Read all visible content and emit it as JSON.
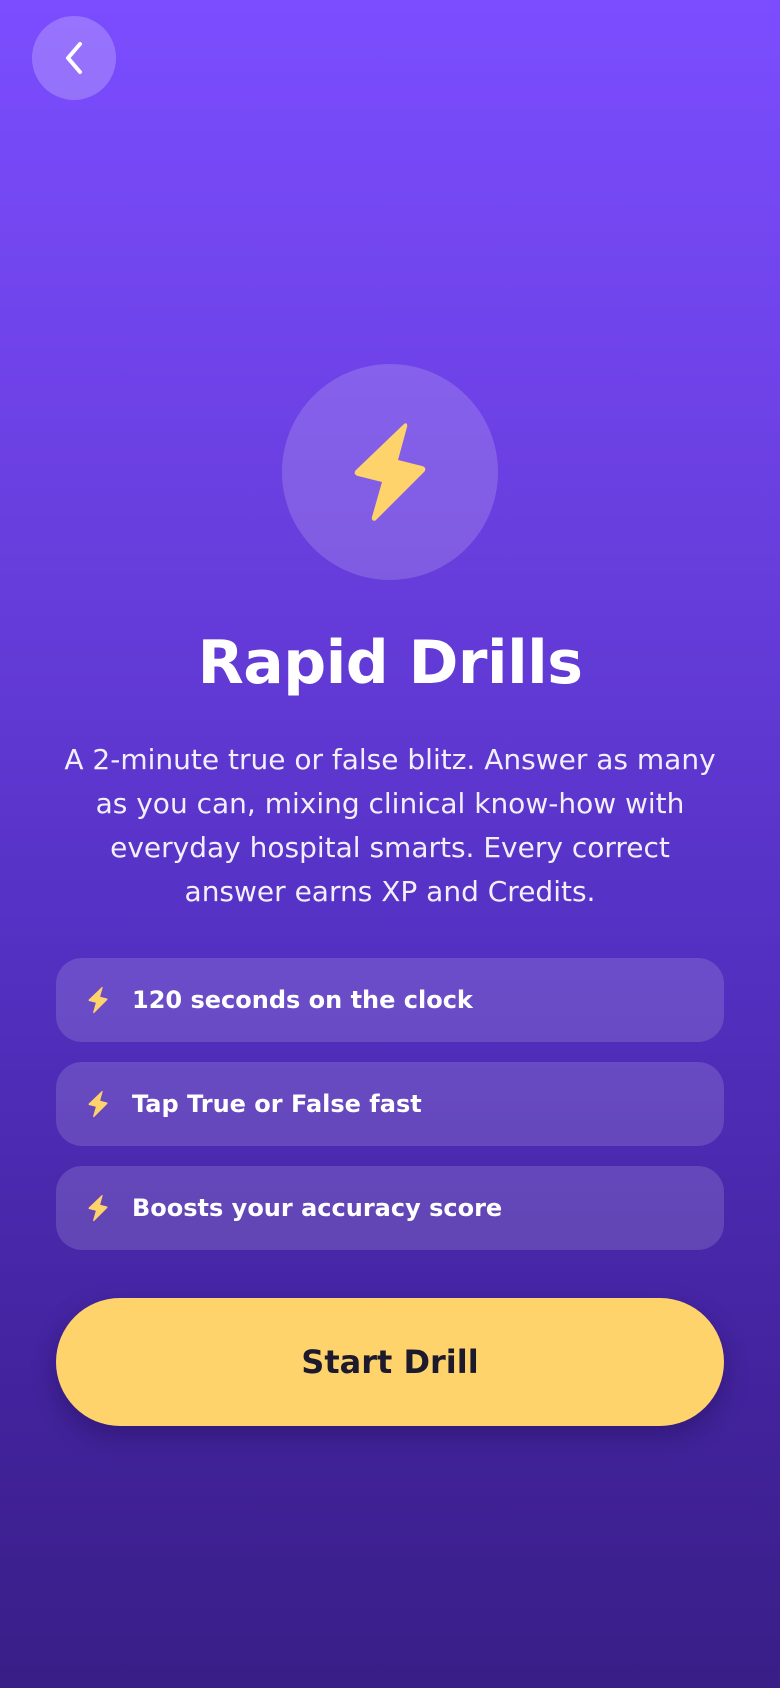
{
  "header": {
    "back_icon": "chevron-left-icon"
  },
  "hero": {
    "icon": "lightning-bolt-icon",
    "icon_color": "#ffd36b"
  },
  "title": "Rapid Drills",
  "description": "A 2-minute true or false blitz. Answer as many as you can, mixing clinical know-how with everyday hospital smarts. Every correct answer earns XP and Credits.",
  "features": [
    {
      "icon": "lightning-bolt-icon",
      "label": "120 seconds on the clock"
    },
    {
      "icon": "lightning-bolt-icon",
      "label": "Tap True or False fast"
    },
    {
      "icon": "lightning-bolt-icon",
      "label": "Boosts your accuracy score"
    }
  ],
  "start_button": {
    "label": "Start Drill",
    "color": "#ffd36b"
  },
  "colors": {
    "background_top": "#7b4dff",
    "background_bottom": "#391e87",
    "accent": "#ffd36b"
  }
}
